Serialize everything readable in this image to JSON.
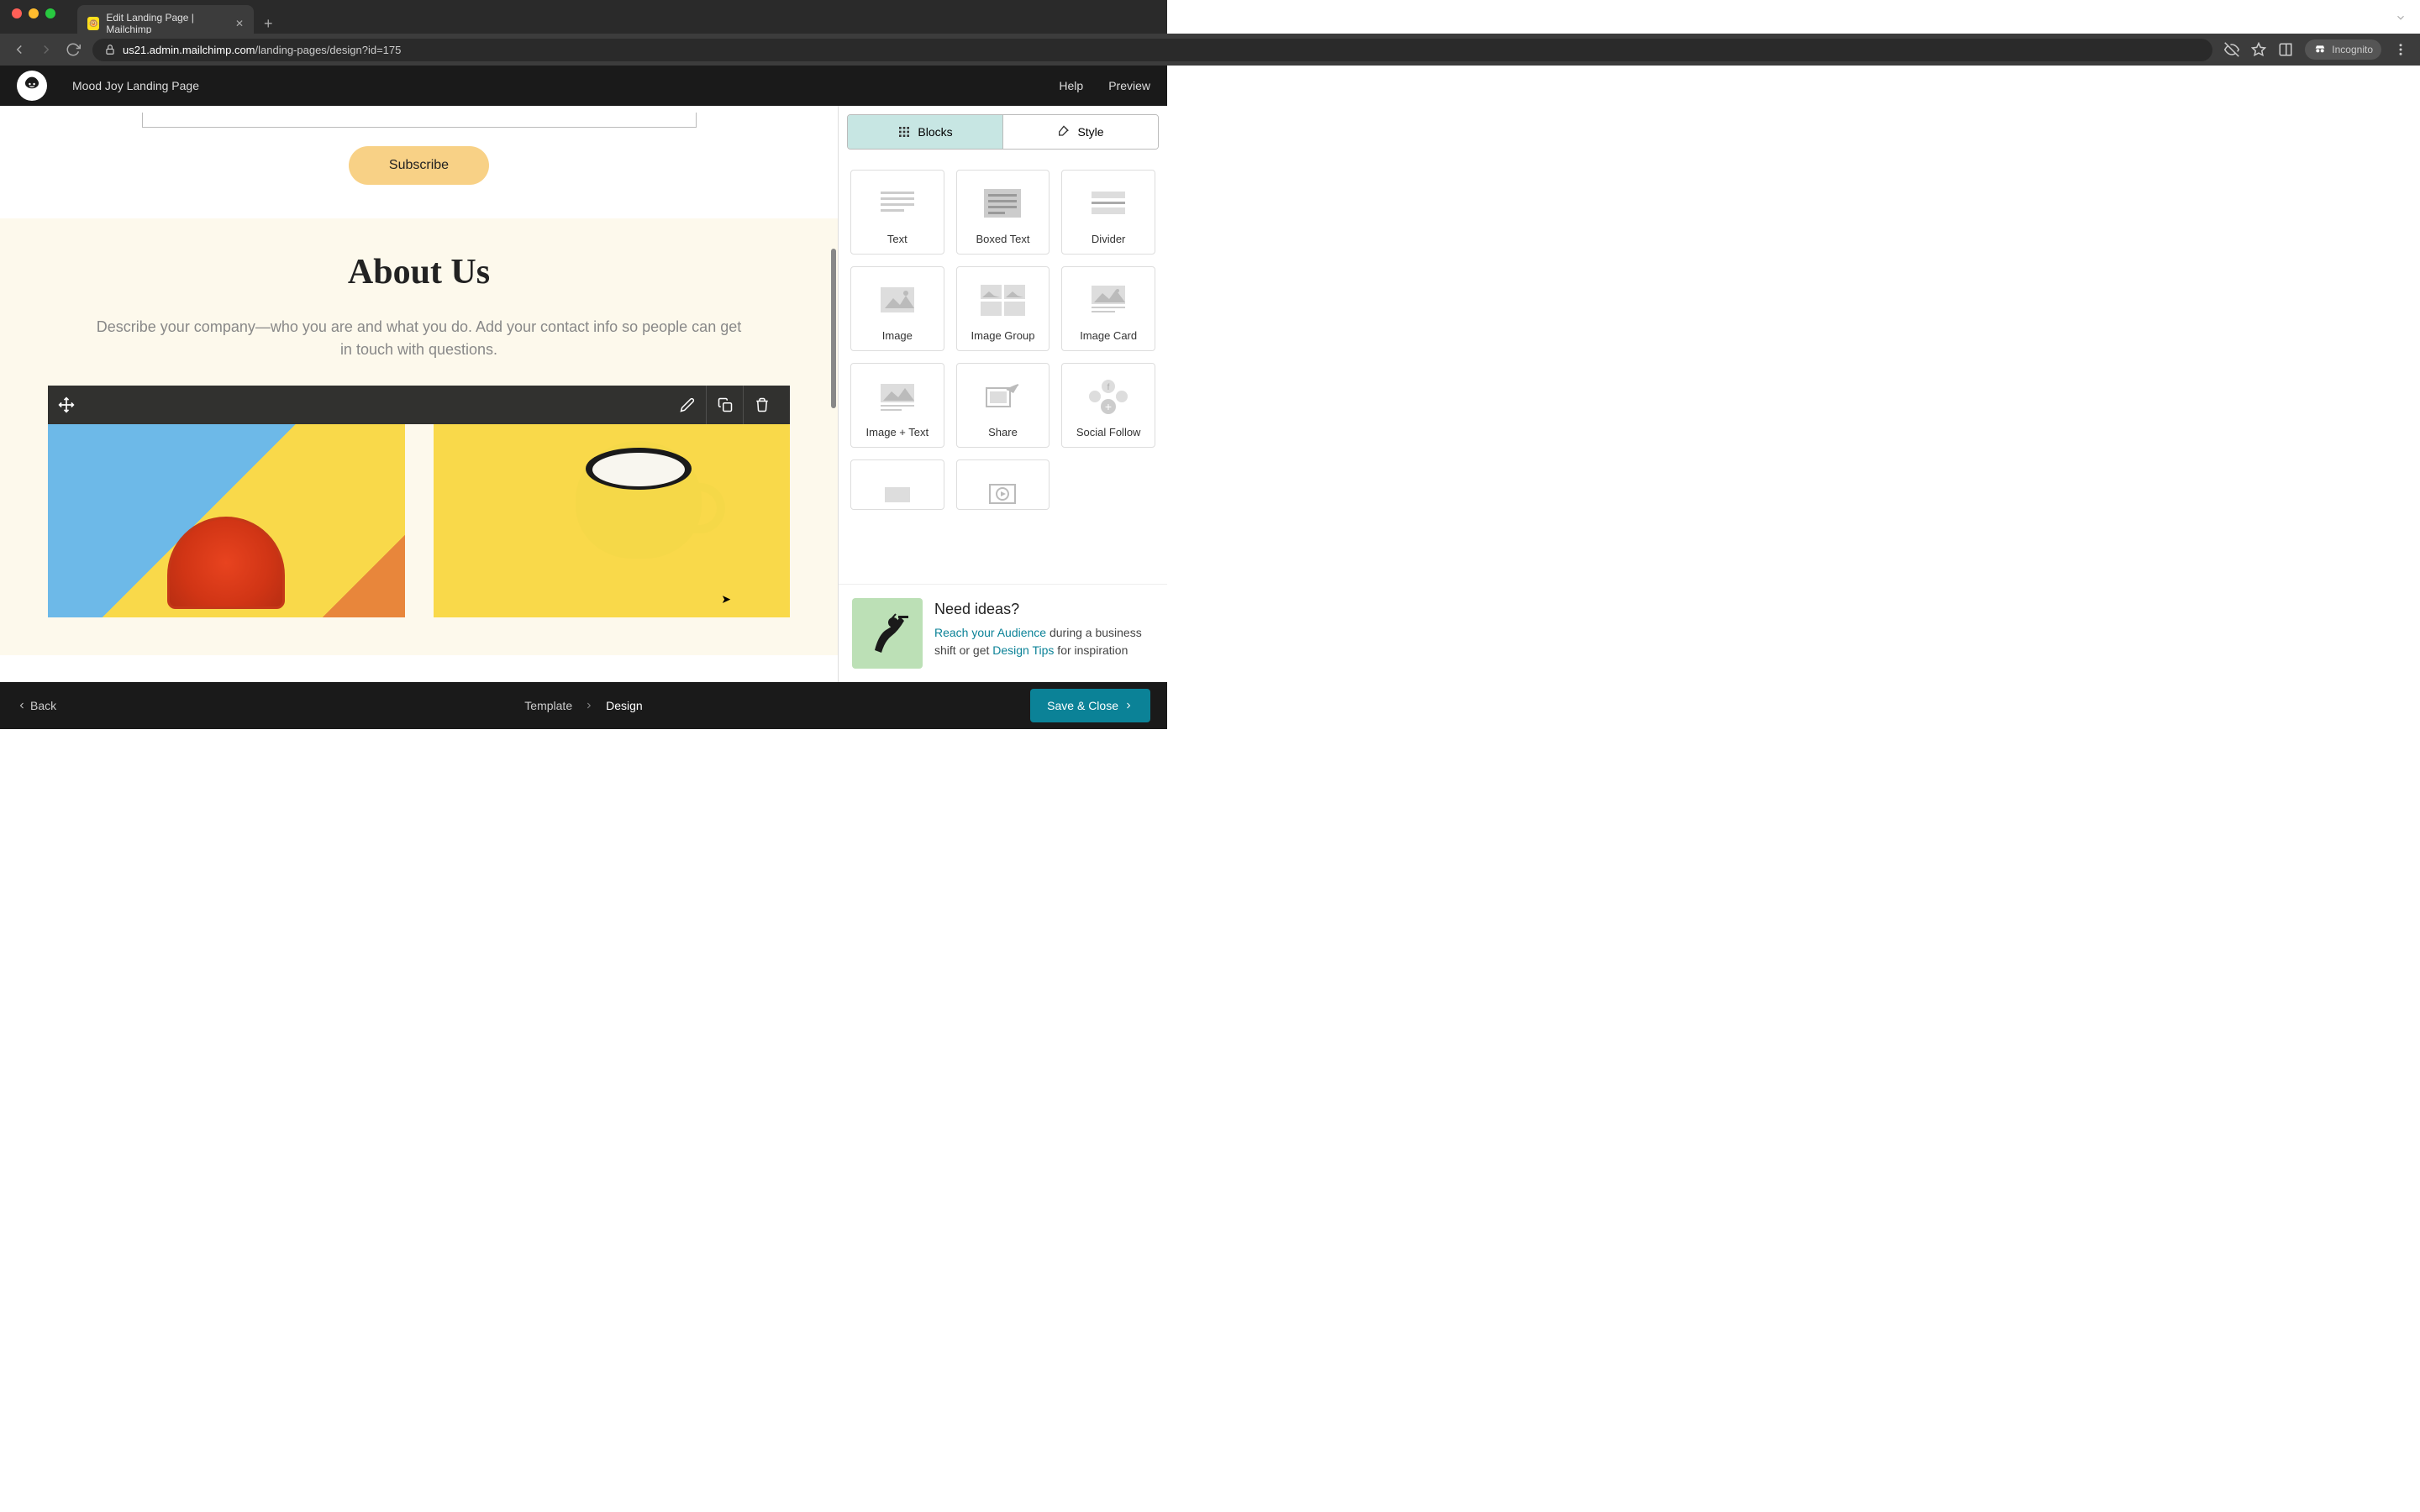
{
  "browser": {
    "tab_title": "Edit Landing Page | Mailchimp",
    "url_prefix": "us21.admin.mailchimp.com",
    "url_path": "/landing-pages/design?id=175",
    "incognito_label": "Incognito"
  },
  "header": {
    "page_name": "Mood Joy Landing Page",
    "help": "Help",
    "preview": "Preview"
  },
  "canvas": {
    "subscribe_label": "Subscribe",
    "about_title": "About Us",
    "about_desc": "Describe your company—who you are and what you do. Add your contact info so people can get in touch with questions."
  },
  "panel": {
    "tab_blocks": "Blocks",
    "tab_style": "Style",
    "blocks": [
      {
        "label": "Text"
      },
      {
        "label": "Boxed Text"
      },
      {
        "label": "Divider"
      },
      {
        "label": "Image"
      },
      {
        "label": "Image Group"
      },
      {
        "label": "Image Card"
      },
      {
        "label": "Image + Text"
      },
      {
        "label": "Share"
      },
      {
        "label": "Social Follow"
      }
    ],
    "ideas": {
      "title": "Need ideas?",
      "link1": "Reach your Audience",
      "text1": " during a business shift or get ",
      "link2": "Design Tips",
      "text2": " for inspiration"
    }
  },
  "footer": {
    "back": "Back",
    "bc_template": "Template",
    "bc_design": "Design",
    "save_close": "Save & Close"
  }
}
